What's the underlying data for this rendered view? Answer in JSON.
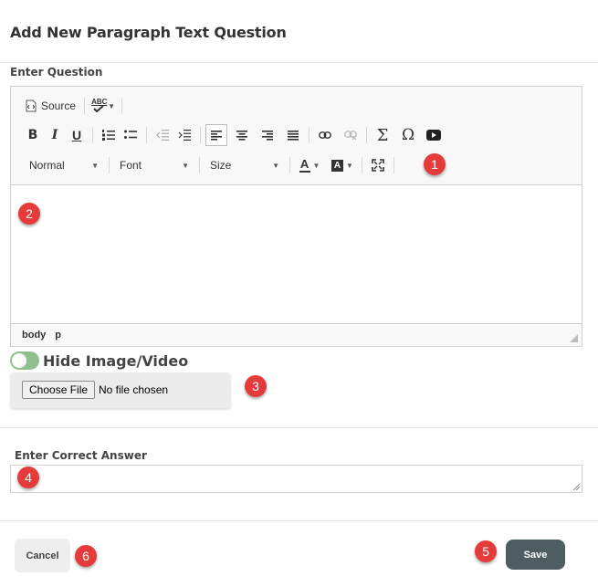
{
  "dialog": {
    "title": "Add New Paragraph Text Question"
  },
  "question": {
    "label": "Enter Question"
  },
  "editor": {
    "source_label": "Source",
    "spellcheck_label": "ABC",
    "format_combo": "Normal",
    "font_combo": "Font",
    "size_combo": "Size",
    "path": [
      "body",
      "p"
    ]
  },
  "media": {
    "toggle_label": "Hide Image/Video",
    "toggle_on": true,
    "choose_file_label": "Choose File",
    "file_status": "No file chosen"
  },
  "answer": {
    "label": "Enter Correct Answer",
    "value": ""
  },
  "footer": {
    "cancel_label": "Cancel",
    "save_label": "Save"
  },
  "markers": [
    "1",
    "2",
    "3",
    "4",
    "5",
    "6"
  ],
  "colors": {
    "marker": "#e63b3b",
    "save_button": "#4d5d60",
    "toggle": "#8fbf8f"
  }
}
